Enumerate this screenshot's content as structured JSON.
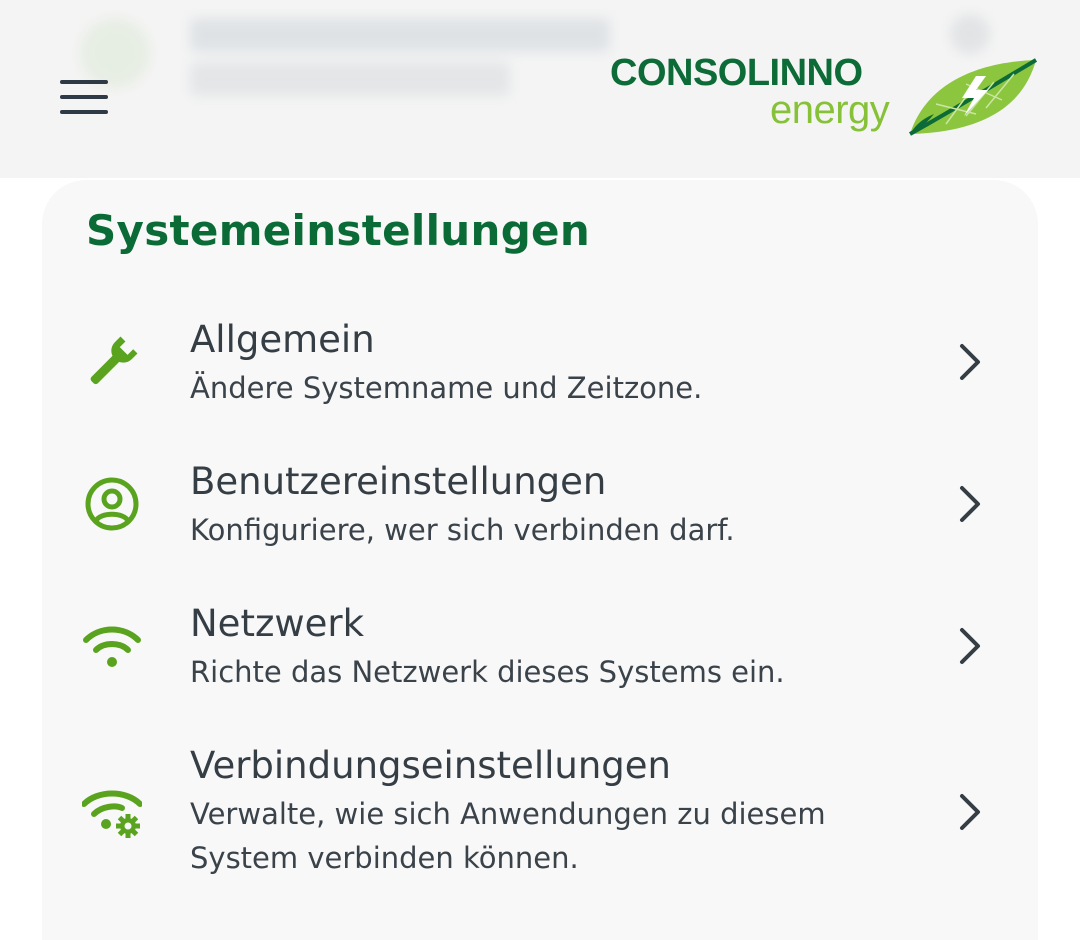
{
  "header": {
    "logo_word": "CONSOLINNO",
    "logo_sub": "energy"
  },
  "page": {
    "title": "Systemeinstellungen"
  },
  "items": [
    {
      "label": "Allgemein",
      "desc": "Ändere Systemname und Zeitzone.",
      "icon": "wrench-icon"
    },
    {
      "label": "Benutzereinstellungen",
      "desc": "Konfiguriere, wer sich verbinden darf.",
      "icon": "user-circle-icon"
    },
    {
      "label": "Netzwerk",
      "desc": "Richte das Netzwerk dieses Systems ein.",
      "icon": "wifi-icon"
    },
    {
      "label": "Verbindungseinstellungen",
      "desc": "Verwalte, wie sich Anwendungen zu diesem System verbinden können.",
      "icon": "wifi-settings-icon"
    }
  ],
  "colors": {
    "brand_dark": "#0b6b36",
    "brand_light": "#86c138",
    "icon_green": "#5aa31f",
    "text": "#353d45"
  }
}
